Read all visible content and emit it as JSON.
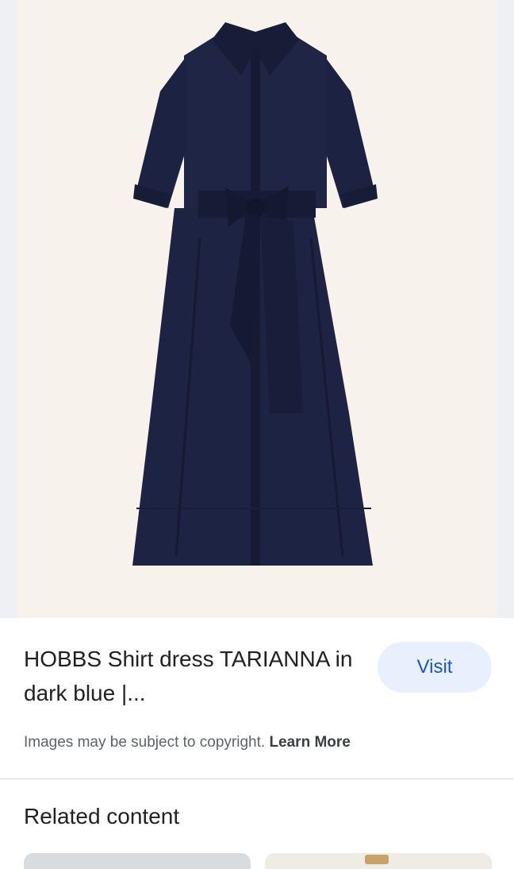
{
  "product": {
    "image_description": "navy-shirt-dress",
    "title": "HOBBS Shirt dress TARIANNA in dark blue |...",
    "visit_label": "Visit"
  },
  "notice": {
    "text": "Images may be subject to copyright.",
    "learn_more": "Learn More"
  },
  "related": {
    "heading": "Related content"
  },
  "colors": {
    "dress": "#1d2342",
    "hero_bg": "#f7f3ec",
    "accent": "#1a56c4",
    "button_bg": "#e8f0fe"
  }
}
